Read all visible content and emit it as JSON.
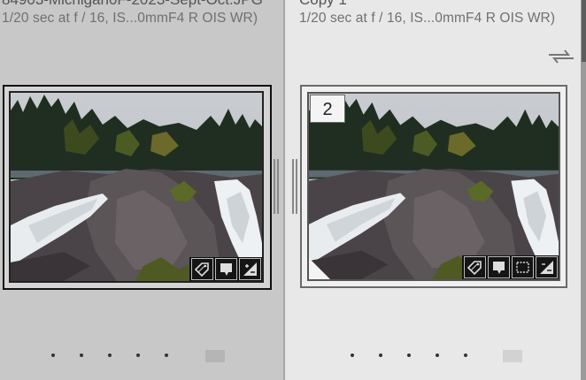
{
  "left_cell": {
    "filename": "84903-Michigan0F-2023-Sept-Oct.JPG",
    "exif": "1/20 sec at f / 16, IS...0mmF4 R OIS WR)"
  },
  "right_cell": {
    "filename": "Copy 1",
    "exif": "1/20 sec at f / 16, IS...0mmF4 R OIS WR)",
    "copy_number": "2"
  },
  "colors": {
    "left_bg": "#c8c8c8",
    "right_bg": "#e8e8e8",
    "badge_bg": "#111111"
  },
  "icons": {
    "keyword": "keyword-tag-icon",
    "comment": "comment-icon",
    "crop": "crop-icon",
    "develop": "develop-adjustment-icon",
    "sync": "sync-arrows-icon"
  }
}
